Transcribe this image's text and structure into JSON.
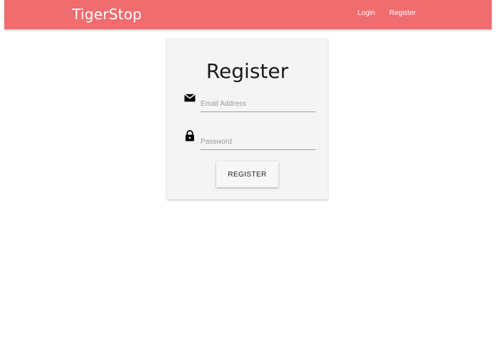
{
  "navbar": {
    "brand": "TigerStop",
    "links": [
      "Login",
      "Register"
    ],
    "background_color": "#ef6c6f"
  },
  "register_card": {
    "title": "Register",
    "email_field": {
      "icon": "mail-icon",
      "placeholder": "Email Address",
      "value": ""
    },
    "password_field": {
      "icon": "lock-icon",
      "placeholder": "Password",
      "value": ""
    },
    "submit_label": "REGISTER"
  }
}
